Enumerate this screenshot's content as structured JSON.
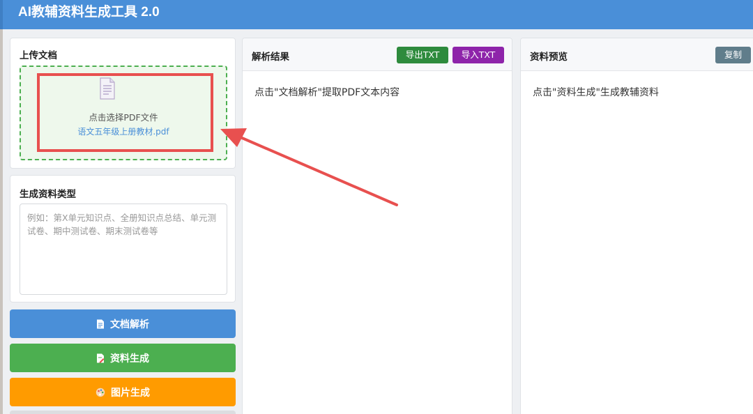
{
  "app": {
    "title": "AI教辅资料生成工具 2.0"
  },
  "upload": {
    "title": "上传文档",
    "prompt": "点击选择PDF文件",
    "file_name": "语文五年级上册教材.pdf"
  },
  "material_type": {
    "title": "生成资料类型",
    "placeholder": "例如：第X单元知识点、全册知识点总结、单元测试卷、期中测试卷、期末测试卷等"
  },
  "actions": {
    "parse_label": "文档解析",
    "generate_label": "资料生成",
    "image_label": "图片生成"
  },
  "parse_result": {
    "title": "解析结果",
    "export_label": "导出TXT",
    "import_label": "导入TXT",
    "placeholder_text": "点击\"文档解析\"提取PDF文本内容"
  },
  "preview": {
    "title": "资料预览",
    "copy_label": "复制",
    "placeholder_text": "点击\"资料生成\"生成教辅资料"
  },
  "colors": {
    "header": "#4a8fd8",
    "parse_button": "#4a8fd8",
    "generate_button": "#4caf50",
    "image_button": "#ff9b00",
    "export_button": "#2e8b3d",
    "import_button": "#8e24aa",
    "copy_button": "#607d8b",
    "annotation": "#e8504f"
  },
  "icons": [
    "file-icon",
    "document-icon",
    "edit-document-icon",
    "palette-icon",
    "annotation-arrow"
  ]
}
